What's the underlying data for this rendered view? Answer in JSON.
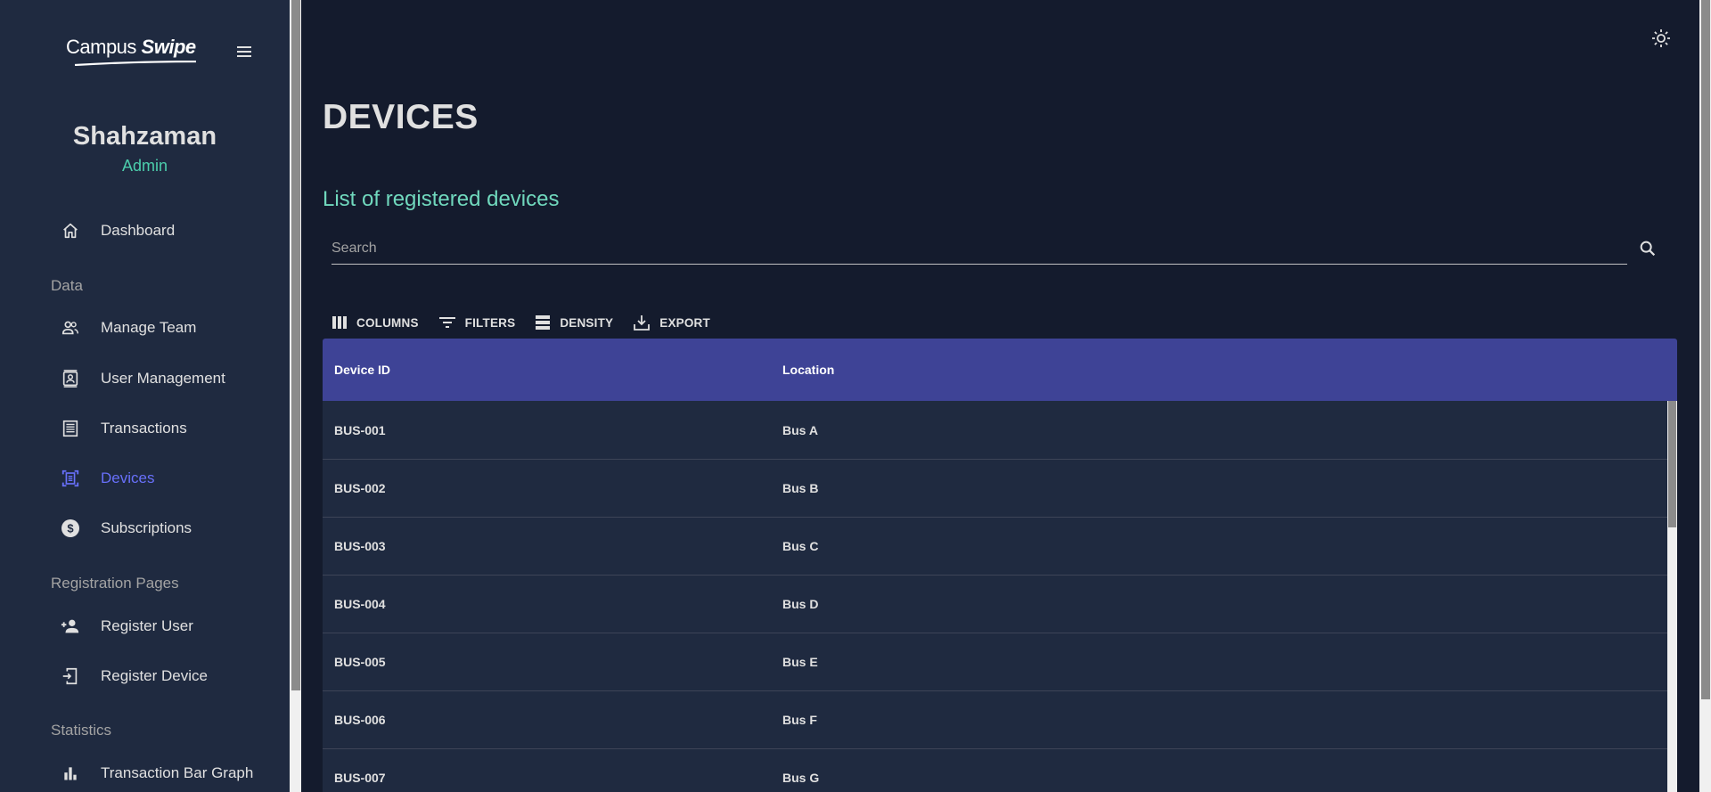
{
  "brand": {
    "logo_text_1": "Campus",
    "logo_text_2": "Swipe"
  },
  "user": {
    "name": "Shahzaman",
    "role": "Admin"
  },
  "sidebar": {
    "dashboard": "Dashboard",
    "section_data": "Data",
    "manage_team": "Manage Team",
    "user_management": "User Management",
    "transactions": "Transactions",
    "devices": "Devices",
    "subscriptions": "Subscriptions",
    "section_registration": "Registration Pages",
    "register_user": "Register User",
    "register_device": "Register Device",
    "section_statistics": "Statistics",
    "transaction_bar_graph": "Transaction Bar Graph",
    "active_item": "Devices"
  },
  "header": {
    "title": "DEVICES",
    "subtitle": "List of registered devices"
  },
  "search": {
    "placeholder": "Search",
    "value": ""
  },
  "toolbar": {
    "columns": "COLUMNS",
    "filters": "FILTERS",
    "density": "DENSITY",
    "export": "EXPORT"
  },
  "table": {
    "columns": [
      "Device ID",
      "Location"
    ],
    "rows": [
      [
        "BUS-001",
        "Bus A"
      ],
      [
        "BUS-002",
        "Bus B"
      ],
      [
        "BUS-003",
        "Bus C"
      ],
      [
        "BUS-004",
        "Bus D"
      ],
      [
        "BUS-005",
        "Bus E"
      ],
      [
        "BUS-006",
        "Bus F"
      ],
      [
        "BUS-007",
        "Bus G"
      ]
    ]
  },
  "colors": {
    "background": "#141b2d",
    "sidebar": "#1f2a40",
    "accent_green": "#4cceac",
    "subtitle_green": "#70d8bd",
    "active_blue": "#6870fa",
    "table_header": "#3e4396"
  },
  "icons": {
    "dashboard": "home-icon",
    "manage_team": "people-icon",
    "user_management": "contact-card-icon",
    "transactions": "receipt-icon",
    "devices": "document-scanner-icon",
    "subscriptions": "dollar-coin-icon",
    "register_user": "person-add-icon",
    "register_device": "mobile-add-icon",
    "transaction_bar_graph": "bar-chart-icon",
    "theme": "sun-icon",
    "search": "search-icon"
  }
}
